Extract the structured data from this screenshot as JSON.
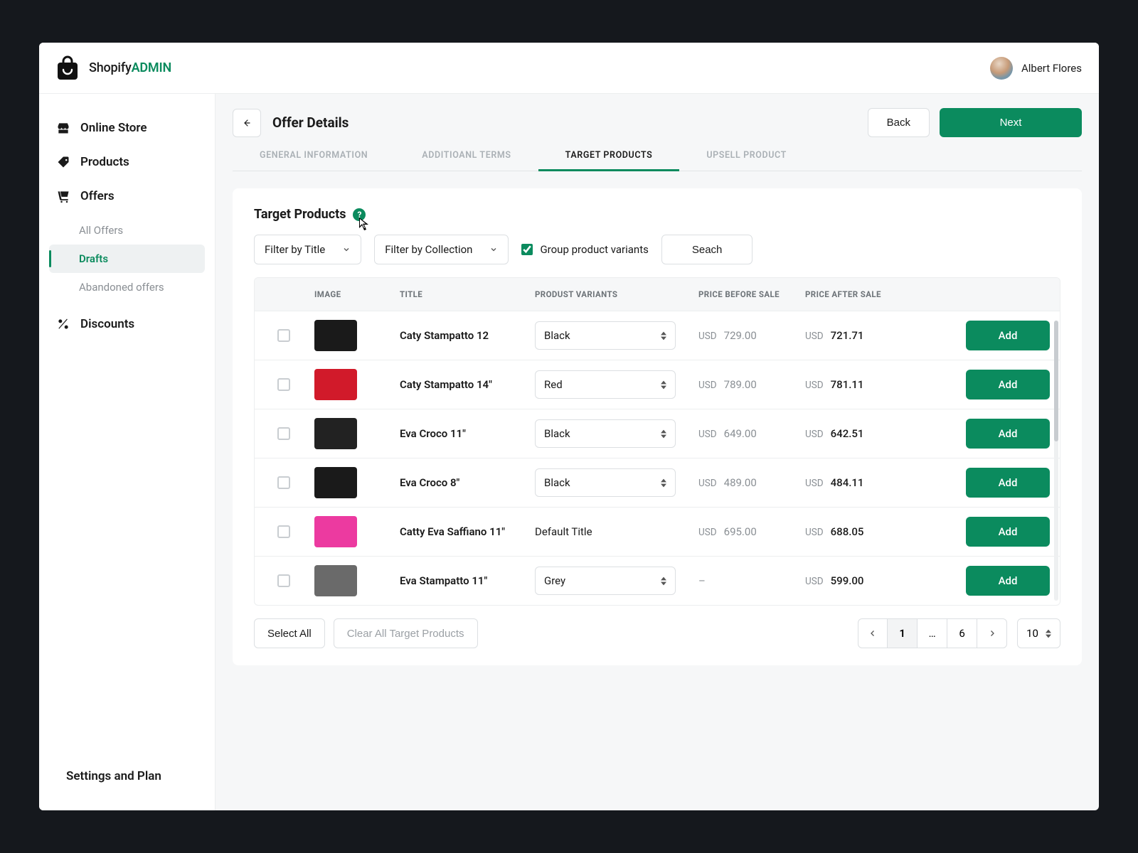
{
  "brand": {
    "name_a": "Shopify",
    "name_b": "ADMIN"
  },
  "user": {
    "name": "Albert Flores"
  },
  "sidebar": {
    "items": [
      {
        "label": "Online Store"
      },
      {
        "label": "Products"
      },
      {
        "label": "Offers"
      },
      {
        "label": "Discounts"
      }
    ],
    "offers_sub": [
      {
        "label": "All Offers"
      },
      {
        "label": "Drafts"
      },
      {
        "label": "Abandoned offers"
      }
    ],
    "footer": "Settings and Plan"
  },
  "page": {
    "title": "Offer Details",
    "back": "Back",
    "next": "Next"
  },
  "tabs": [
    "GENERAL INFORMATION",
    "ADDITIOANL TERMS",
    "TARGET PRODUCTS",
    "UPSELL PRODUCT"
  ],
  "section": {
    "title": "Target Products",
    "filter_title": "Filter by Title",
    "filter_collection": "Filter by Collection",
    "group_variants": "Group product variants",
    "search": "Seach"
  },
  "columns": {
    "image": "IMAGE",
    "title": "TITLE",
    "variants": "PRODUST VARIANTS",
    "before": "PRICE BEFORE SALE",
    "after": "PRICE AFTER SALE"
  },
  "rows": [
    {
      "title": "Caty Stampatto 12",
      "variant": "Black",
      "has_select": true,
      "cur": "USD",
      "before": "729.00",
      "after": "721.71",
      "thumb": "#1a1a1a"
    },
    {
      "title": "Caty Stampatto 14\"",
      "variant": "Red",
      "has_select": true,
      "cur": "USD",
      "before": "789.00",
      "after": "781.11",
      "thumb": "#d11a2a"
    },
    {
      "title": "Eva Croco 11\"",
      "variant": "Black",
      "has_select": true,
      "cur": "USD",
      "before": "649.00",
      "after": "642.51",
      "thumb": "#222222"
    },
    {
      "title": "Eva Croco 8\"",
      "variant": "Black",
      "has_select": true,
      "cur": "USD",
      "before": "489.00",
      "after": "484.11",
      "thumb": "#1a1a1a"
    },
    {
      "title": "Catty Eva Saffiano 11\"",
      "variant": "Default Title",
      "has_select": false,
      "cur": "USD",
      "before": "695.00",
      "after": "688.05",
      "thumb": "#ec3aa0"
    },
    {
      "title": "Eva Stampatto 11\"",
      "variant": "Grey",
      "has_select": true,
      "cur": "USD",
      "before": "–",
      "after": "599.00",
      "thumb": "#6a6a6a",
      "no_before_cur": true
    }
  ],
  "row_add": "Add",
  "footer": {
    "select_all": "Select All",
    "clear_all": "Clear All Target Products",
    "ellipsis": "…",
    "page_current": "1",
    "page_last": "6",
    "per_page": "10"
  },
  "colors": {
    "primary": "#0b8b5e"
  }
}
